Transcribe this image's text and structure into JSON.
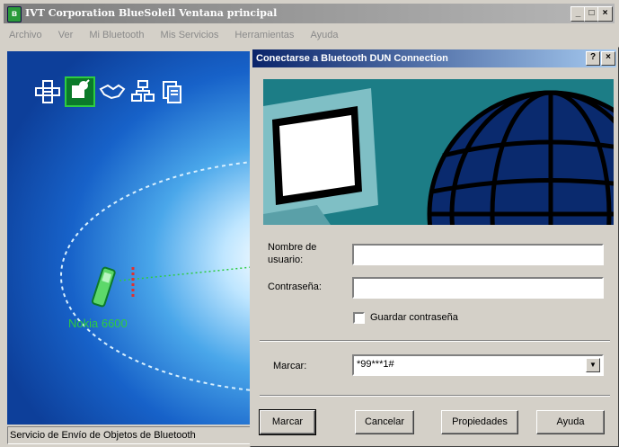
{
  "main_window": {
    "title": "IVT Corporation BlueSoleil Ventana principal",
    "icon": "bluetooth-icon",
    "controls": {
      "minimize": "_",
      "maximize": "□",
      "close": "×"
    }
  },
  "menu": [
    "Archivo",
    "Ver",
    "Mi Bluetooth",
    "Mis Servicios",
    "Herramientas",
    "Ayuda"
  ],
  "toolbar_icons": [
    "network-icon",
    "dun-icon",
    "handshake-icon",
    "lan-icon",
    "file-transfer-icon"
  ],
  "device": {
    "name": "Nokia 6600",
    "icon": "phone-icon"
  },
  "status_text": "Servicio de Envío de Objetos de Bluetooth",
  "dialog": {
    "title": "Conectarse a Bluetooth DUN Connection",
    "help": "?",
    "close": "×",
    "username_label_1": "Nombre de",
    "username_label_2": "usuario:",
    "username_value": "",
    "password_label": "Contraseña:",
    "password_value": "",
    "save_password_label": "Guardar contraseña",
    "save_password_checked": false,
    "dial_label": "Marcar:",
    "dial_value": "*99***1#",
    "buttons": {
      "dial": "Marcar",
      "cancel": "Cancelar",
      "properties": "Propiedades",
      "help": "Ayuda"
    }
  },
  "colors": {
    "dialog_title": "#0a246a",
    "selected_icon": "#0b7a2a",
    "device_text": "#2ecc40"
  }
}
